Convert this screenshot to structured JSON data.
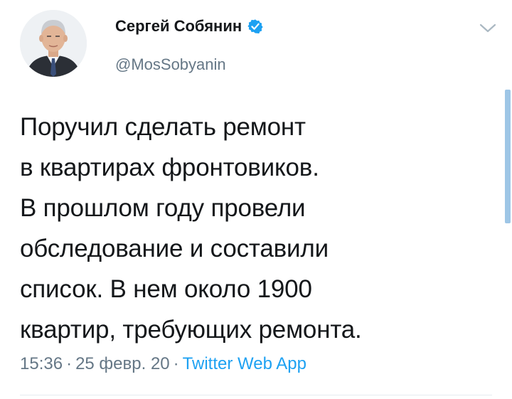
{
  "author": {
    "name": "Сергей Собянин",
    "handle": "@MosSobyanin",
    "verified": true
  },
  "tweet": {
    "lines": [
      "Поручил сделать ремонт",
      "в квартирах фронтовиков.",
      "В прошлом году провели",
      "обследование и составили",
      "список. В нем около 1900",
      "квартир, требующих ремонта."
    ],
    "time": "15:36",
    "date": "25 февр. 20",
    "source": "Twitter Web App",
    "separator": "·"
  },
  "icons": {
    "verified": "verified-badge-icon",
    "menu": "chevron-down-icon"
  },
  "colors": {
    "accent": "#1da1f2",
    "text": "#14171a",
    "secondary": "#657786"
  }
}
